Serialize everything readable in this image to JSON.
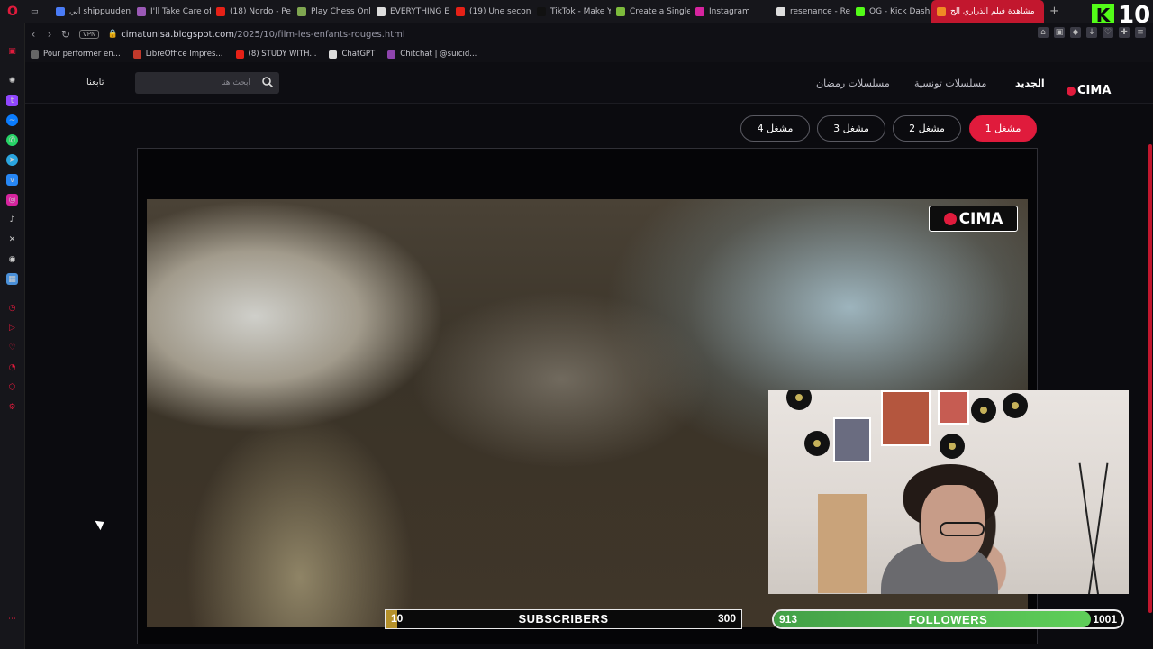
{
  "tabs": [
    {
      "label": "اني shippuuden",
      "color": "#4a7cf7"
    },
    {
      "label": "I'll Take Care of",
      "color": "#9b59b6"
    },
    {
      "label": "(18) Nordo - Pe",
      "color": "#e62117"
    },
    {
      "label": "Play Chess Onli",
      "color": "#7fa650"
    },
    {
      "label": "EVERYTHING E",
      "color": "#dddddd"
    },
    {
      "label": "(19) Une seconde",
      "color": "#e62117"
    },
    {
      "label": "TikTok - Make Y",
      "color": "#111111"
    },
    {
      "label": "Create a Single",
      "color": "#7dbb3c"
    },
    {
      "label": "Instagram",
      "color": "#d6249f"
    },
    {
      "label": "resenance - Re",
      "color": "#dddddd"
    },
    {
      "label": "OG - Kick Dashb",
      "color": "#53fc18"
    },
    {
      "label": "مشاهدة فيلم الذراري الح",
      "color": "#f08a24"
    }
  ],
  "kick_count": "10",
  "address": {
    "vpn": "VPN",
    "domain": "cimatunisa.blogspot.com",
    "path": "/2025/10/film-les-enfants-rouges.html"
  },
  "bookmarks": [
    {
      "label": "Pour performer en...",
      "color": "#666666"
    },
    {
      "label": "LibreOffice Impres...",
      "color": "#c0392b"
    },
    {
      "label": "(8) STUDY WITH...",
      "color": "#e62117"
    },
    {
      "label": "ChatGPT",
      "color": "#dddddd"
    },
    {
      "label": "Chitchat | @suicid...",
      "color": "#8e44ad"
    }
  ],
  "site": {
    "logo": "CIMA",
    "menu": [
      "الجديد",
      "مسلسلات تونسية",
      "مسلسلات رمضان"
    ],
    "search_placeholder": "ابحث هنا",
    "follow_link": "تابعنا",
    "servers": [
      "مشغل 1",
      "مشغل 2",
      "مشغل 3",
      "مشغل 4"
    ],
    "watermark": "CIMA"
  },
  "overlay": {
    "subscribers": {
      "current": "10",
      "label": "SUBSCRIBERS",
      "goal": "300",
      "progress": 0.033
    },
    "followers": {
      "current": "913",
      "label": "FOLLOWERS",
      "goal": "1001",
      "progress": 0.91
    }
  },
  "colors": {
    "accent": "#e01b3c",
    "kick": "#53fc18"
  }
}
